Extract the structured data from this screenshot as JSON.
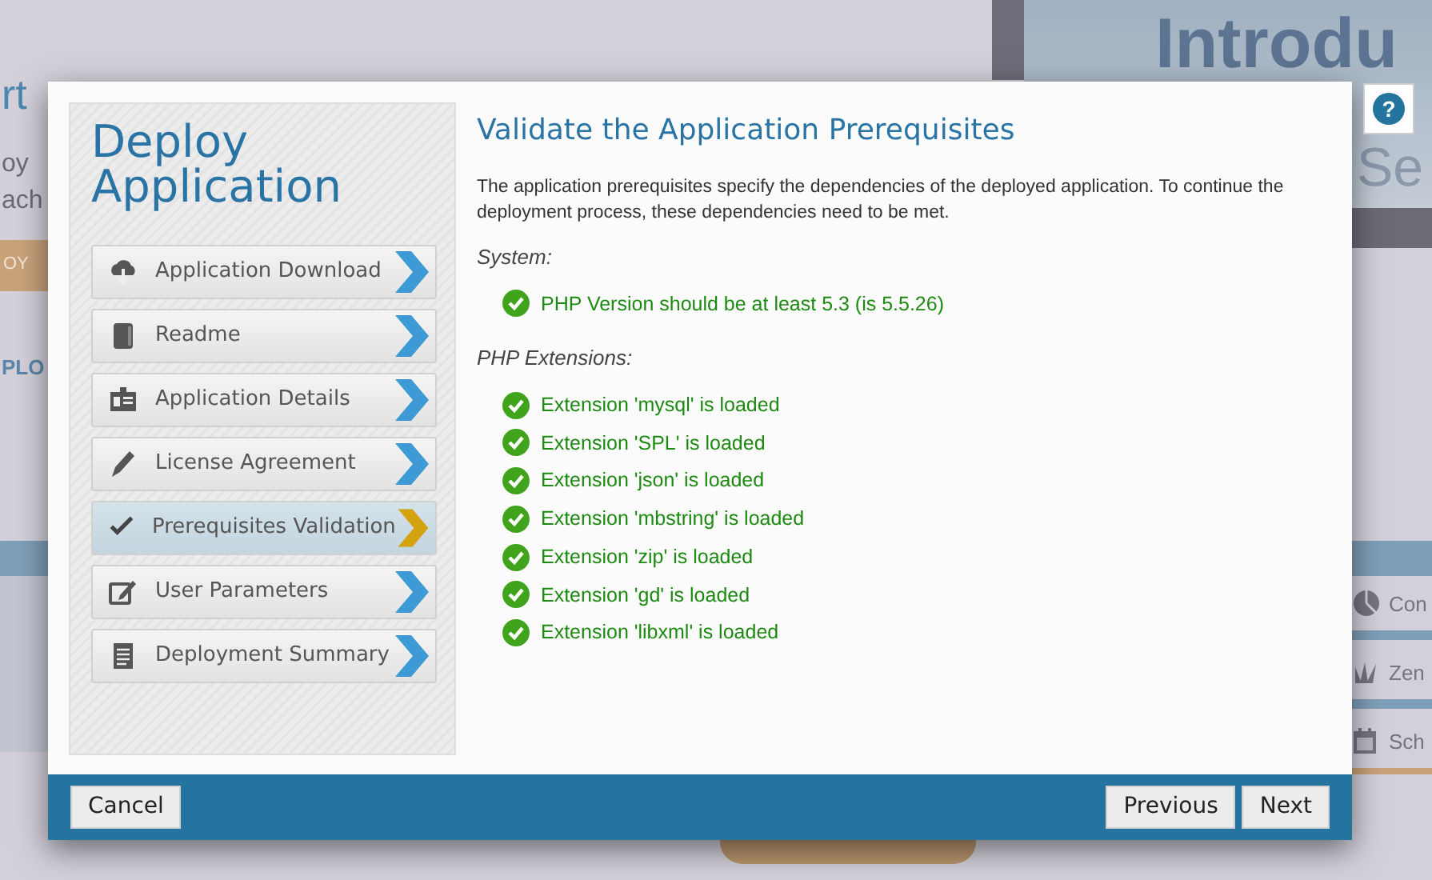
{
  "background": {
    "fragments": [
      "Introdu",
      "Se",
      "rt",
      "oy",
      "ach",
      "OY",
      "PLO",
      "Con",
      "Zen",
      "Sch"
    ]
  },
  "help_button": {
    "label": "?"
  },
  "sidebar": {
    "title": "Deploy Application",
    "steps": [
      {
        "label": "Application Download",
        "selected": false
      },
      {
        "label": "Readme",
        "selected": false
      },
      {
        "label": "Application Details",
        "selected": false
      },
      {
        "label": "License Agreement",
        "selected": false
      },
      {
        "label": "Prerequisites Validation",
        "selected": true
      },
      {
        "label": "User Parameters",
        "selected": false
      },
      {
        "label": "Deployment Summary",
        "selected": false
      }
    ]
  },
  "content": {
    "title": "Validate the Application Prerequisites",
    "description": "The application prerequisites specify the dependencies of the deployed application. To continue the deployment process, these dependencies need to be met.",
    "sections": [
      {
        "label": "System:",
        "items": [
          {
            "text": "PHP Version should be at least 5.3 (is 5.5.26)",
            "passed": true
          }
        ]
      },
      {
        "label": "PHP Extensions:",
        "items": [
          {
            "text": "Extension 'mysql' is loaded",
            "passed": true
          },
          {
            "text": "Extension 'SPL' is loaded",
            "passed": true
          },
          {
            "text": "Extension 'json' is loaded",
            "passed": true
          },
          {
            "text": "Extension 'mbstring' is loaded",
            "passed": true
          },
          {
            "text": "Extension 'zip' is loaded",
            "passed": true
          },
          {
            "text": "Extension 'gd' is loaded",
            "passed": true
          },
          {
            "text": "Extension 'libxml' is loaded",
            "passed": true
          }
        ]
      }
    ]
  },
  "footer": {
    "left_buttons": [
      "Cancel"
    ],
    "right_buttons": [
      "Previous",
      "Next"
    ]
  }
}
